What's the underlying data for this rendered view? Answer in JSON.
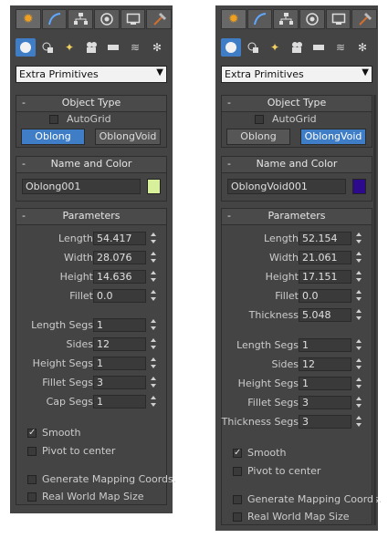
{
  "panels": [
    {
      "dropdown": "Extra Primitives",
      "object_type_title": "Object Type",
      "autogrid_label": "AutoGrid",
      "buttons": [
        "Oblong",
        "OblongVoid"
      ],
      "active_button": 0,
      "name_color_title": "Name and Color",
      "object_name": "Oblong001",
      "color": "#d8f09a",
      "parameters_title": "Parameters",
      "fields": [
        {
          "label": "Length",
          "value": "54.417"
        },
        {
          "label": "Width",
          "value": "28.076"
        },
        {
          "label": "Height",
          "value": "14.636"
        },
        {
          "label": "Fillet",
          "value": "0.0"
        }
      ],
      "segs": [
        {
          "label": "Length Segs",
          "value": "1"
        },
        {
          "label": "Sides",
          "value": "12"
        },
        {
          "label": "Height Segs",
          "value": "1"
        },
        {
          "label": "Fillet Segs",
          "value": "3"
        },
        {
          "label": "Cap Segs",
          "value": "1"
        }
      ],
      "checks": [
        {
          "label": "Smooth",
          "checked": true
        },
        {
          "label": "Pivot to center",
          "checked": false
        }
      ],
      "checks2": [
        {
          "label": "Generate Mapping Coords.",
          "checked": false
        },
        {
          "label": "Real World Map Size",
          "checked": false
        }
      ]
    },
    {
      "dropdown": "Extra Primitives",
      "object_type_title": "Object Type",
      "autogrid_label": "AutoGrid",
      "buttons": [
        "Oblong",
        "OblongVoid"
      ],
      "active_button": 1,
      "name_color_title": "Name and Color",
      "object_name": "OblongVoid001",
      "color": "#2d0a8c",
      "parameters_title": "Parameters",
      "fields": [
        {
          "label": "Length",
          "value": "52.154"
        },
        {
          "label": "Width",
          "value": "21.061"
        },
        {
          "label": "Height",
          "value": "17.151"
        },
        {
          "label": "Fillet",
          "value": "0.0"
        },
        {
          "label": "Thickness",
          "value": "5.048"
        }
      ],
      "segs": [
        {
          "label": "Length Segs",
          "value": "1"
        },
        {
          "label": "Sides",
          "value": "12"
        },
        {
          "label": "Height Segs",
          "value": "1"
        },
        {
          "label": "Fillet Segs",
          "value": "3"
        },
        {
          "label": "Thickness Segs",
          "value": "3"
        }
      ],
      "checks": [
        {
          "label": "Smooth",
          "checked": true
        },
        {
          "label": "Pivot to center",
          "checked": false
        }
      ],
      "checks2": [
        {
          "label": "Generate Mapping Coords.",
          "checked": false
        },
        {
          "label": "Real World Map Size",
          "checked": false
        }
      ]
    }
  ],
  "tab_icons": [
    "create-icon",
    "modify-icon",
    "hierarchy-icon",
    "motion-icon",
    "display-icon",
    "utilities-icon"
  ],
  "category_icons": [
    "geometry-icon",
    "shapes-icon",
    "lights-icon",
    "cameras-icon",
    "helpers-icon",
    "spacewarps-icon",
    "systems-icon"
  ]
}
